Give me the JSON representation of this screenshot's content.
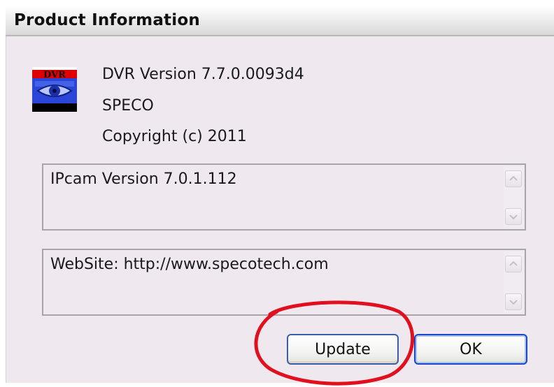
{
  "dialog": {
    "title": "Product Information"
  },
  "info": {
    "logo_text": "DVR",
    "version": "DVR Version 7.7.0.0093d4",
    "company": "SPECO",
    "copyright": "Copyright (c) 2011"
  },
  "ipcam_box": {
    "text": "IPcam Version 7.0.1.112"
  },
  "website_box": {
    "text": "WebSite: http://www.specotech.com"
  },
  "buttons": {
    "update_label": "Update",
    "ok_label": "OK"
  },
  "colors": {
    "dialog_bg": "#efe8ef",
    "button_border": "#1b47c8",
    "annotation_circle": "#e0101e",
    "logo_red": "#e00000",
    "logo_blue": "#2b45d8"
  }
}
